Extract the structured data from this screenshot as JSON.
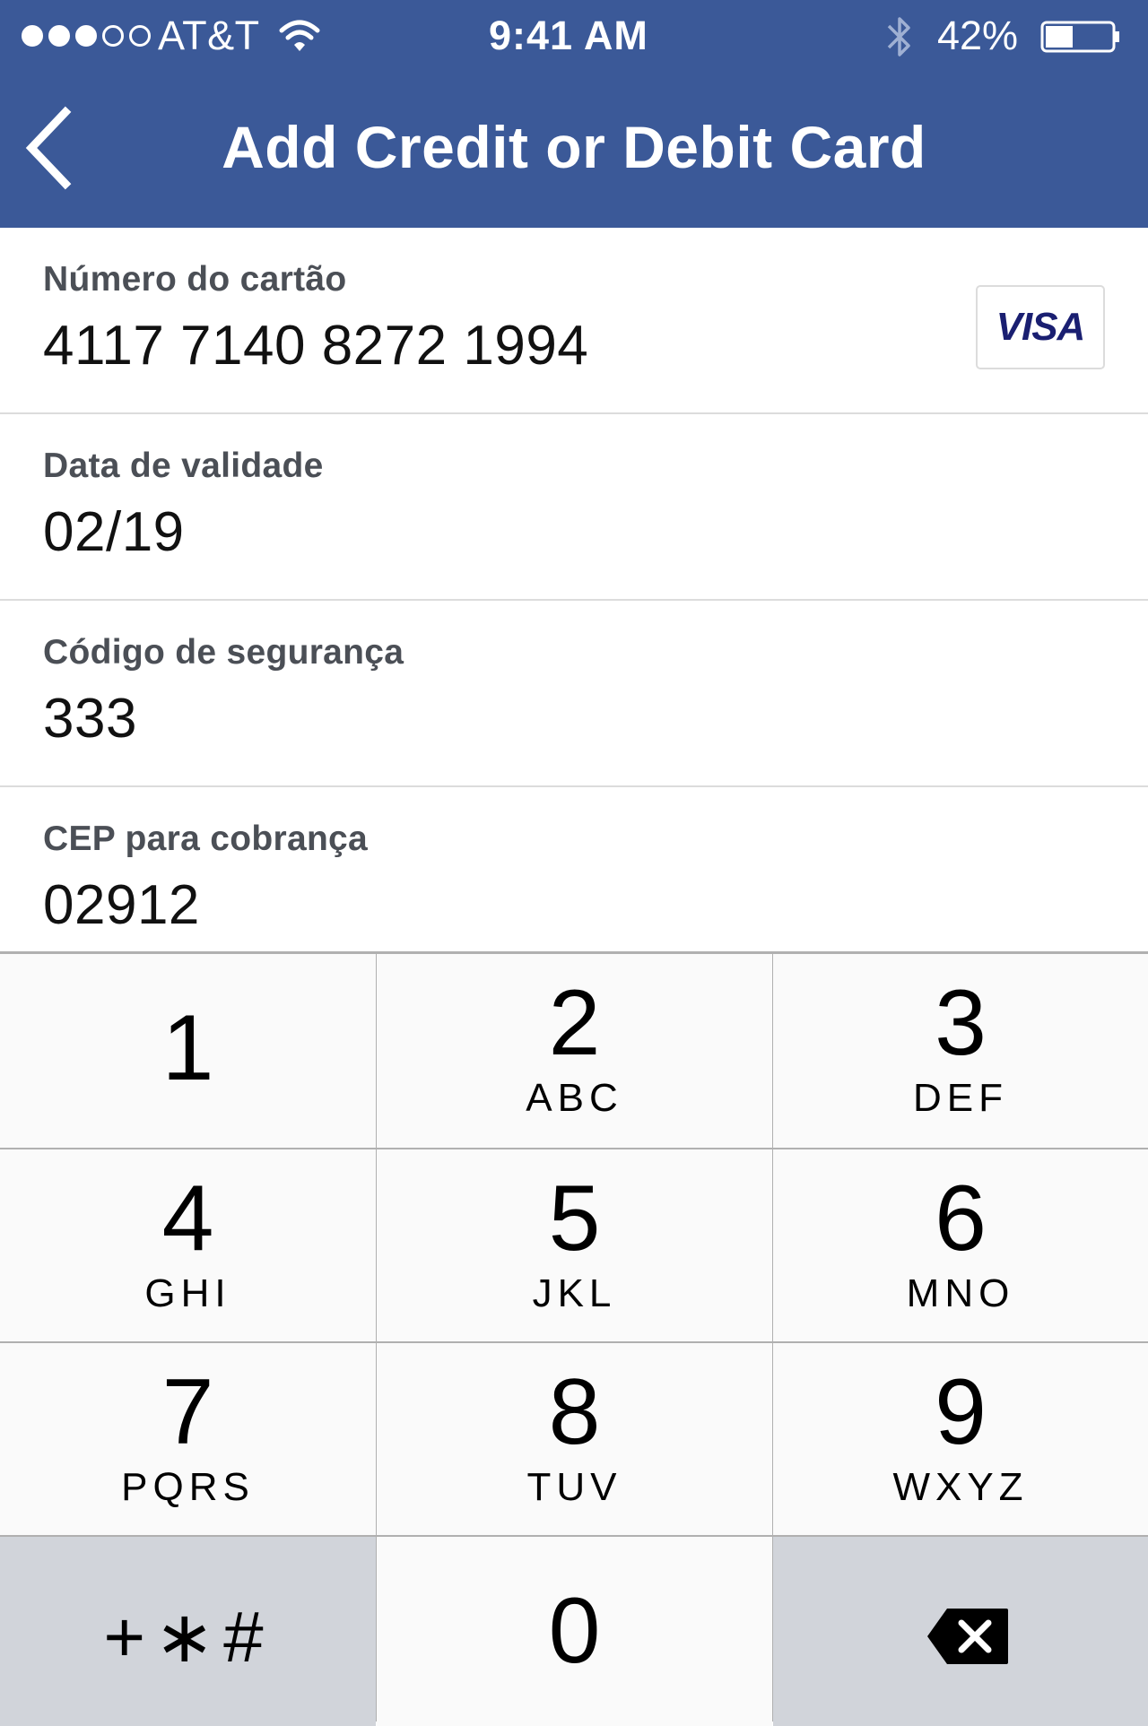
{
  "status_bar": {
    "carrier": "AT&T",
    "time": "9:41 AM",
    "battery": "42%",
    "battery_level": 0.42,
    "signal_bars_filled": 3,
    "signal_bars_total": 5
  },
  "nav": {
    "back_icon": "chevron-left-icon",
    "title": "Add Credit or Debit Card"
  },
  "fields": [
    {
      "label": "Número do cartão",
      "value": "4117 7140 8272 1994"
    },
    {
      "label": "Data de validade",
      "value": "02/19"
    },
    {
      "label": "Código de segurança",
      "value": "333"
    },
    {
      "label": "CEP para cobrança",
      "value": "02912"
    }
  ],
  "card_brand": "VISA",
  "keypad": {
    "keys": [
      {
        "digit": "1",
        "letters": ""
      },
      {
        "digit": "2",
        "letters": "ABC"
      },
      {
        "digit": "3",
        "letters": "DEF"
      },
      {
        "digit": "4",
        "letters": "GHI"
      },
      {
        "digit": "5",
        "letters": "JKL"
      },
      {
        "digit": "6",
        "letters": "MNO"
      },
      {
        "digit": "7",
        "letters": "PQRS"
      },
      {
        "digit": "8",
        "letters": "TUV"
      },
      {
        "digit": "9",
        "letters": "WXYZ"
      }
    ],
    "symbols": "+∗#",
    "zero": "0",
    "backspace_icon": "backspace-icon"
  },
  "colors": {
    "header": "#3b5998",
    "visa": "#1a1f71",
    "key_light": "#fafafa",
    "key_dark": "#d1d4da"
  }
}
